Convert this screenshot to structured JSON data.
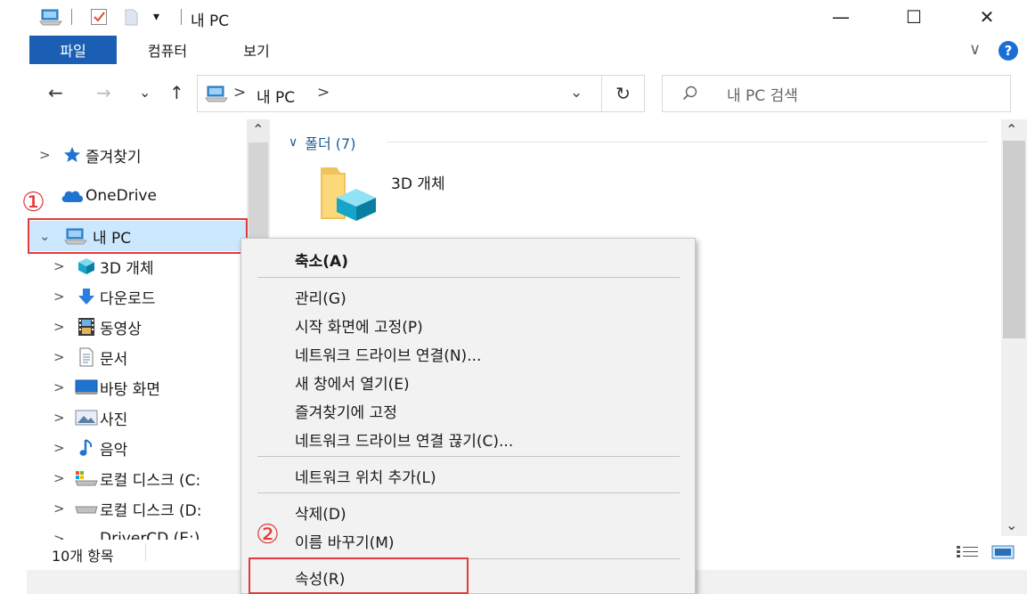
{
  "window": {
    "title": "내 PC",
    "quick_access_dropdown": "▾",
    "minimize": "—",
    "maximize": "☐",
    "close": "✕"
  },
  "ribbon": {
    "tabs": [
      "파일",
      "컴퓨터",
      "보기"
    ],
    "expand": "∨",
    "help": "?"
  },
  "address_bar": {
    "back": "←",
    "forward": "→",
    "recent": "⌄",
    "up": "↑",
    "path_separator": ">",
    "path": "내 PC",
    "path_trailing": ">",
    "dropdown": "⌄",
    "refresh": "↻",
    "search_placeholder": "내 PC 검색"
  },
  "nav_pane": {
    "scroll_up": "⌃",
    "items": [
      {
        "label": "즐겨찾기",
        "chevron": ">",
        "icon": "star-icon"
      },
      {
        "label": "OneDrive",
        "chevron": "",
        "icon": "cloud-icon"
      },
      {
        "label": "내 PC",
        "chevron": "⌄",
        "icon": "pc-icon",
        "selected": true
      },
      {
        "label": "3D 개체",
        "chevron": ">",
        "icon": "cube-icon"
      },
      {
        "label": "다운로드",
        "chevron": ">",
        "icon": "download-icon"
      },
      {
        "label": "동영상",
        "chevron": ">",
        "icon": "video-icon"
      },
      {
        "label": "문서",
        "chevron": ">",
        "icon": "document-icon"
      },
      {
        "label": "바탕 화면",
        "chevron": ">",
        "icon": "desktop-icon"
      },
      {
        "label": "사진",
        "chevron": ">",
        "icon": "picture-icon"
      },
      {
        "label": "음악",
        "chevron": ">",
        "icon": "music-icon"
      },
      {
        "label": "로컬 디스크 (C:",
        "chevron": ">",
        "icon": "drive-c-icon"
      },
      {
        "label": "로컬 디스크 (D:",
        "chevron": ">",
        "icon": "drive-d-icon"
      },
      {
        "label": "DriverCD (E:)",
        "chevron": ">",
        "icon": "cd-drive-icon"
      }
    ]
  },
  "content": {
    "group_chevron": "∨",
    "group_header": "폴더 (7)",
    "folders": [
      {
        "label": "3D 개체",
        "icon": "3d-objects-folder-icon"
      }
    ],
    "scroll_up": "⌃",
    "scroll_down": "⌄"
  },
  "status_bar": {
    "item_count": "10개 항목"
  },
  "context_menu": {
    "groups": [
      [
        "축소(A)"
      ],
      [
        "관리(G)",
        "시작 화면에 고정(P)",
        "네트워크 드라이브 연결(N)...",
        "새 창에서 열기(E)",
        "즐겨찾기에 고정",
        "네트워크 드라이브 연결 끊기(C)..."
      ],
      [
        "네트워크 위치 추가(L)"
      ],
      [
        "삭제(D)",
        "이름 바꾸기(M)"
      ],
      [
        "속성(R)"
      ]
    ]
  },
  "annotations": {
    "step1": "①",
    "step2": "②"
  },
  "colors": {
    "accent": "#1a5fb4",
    "selected_bg": "#cce8ff",
    "highlight": "#e23b3b",
    "group_header": "#1e5c97"
  }
}
